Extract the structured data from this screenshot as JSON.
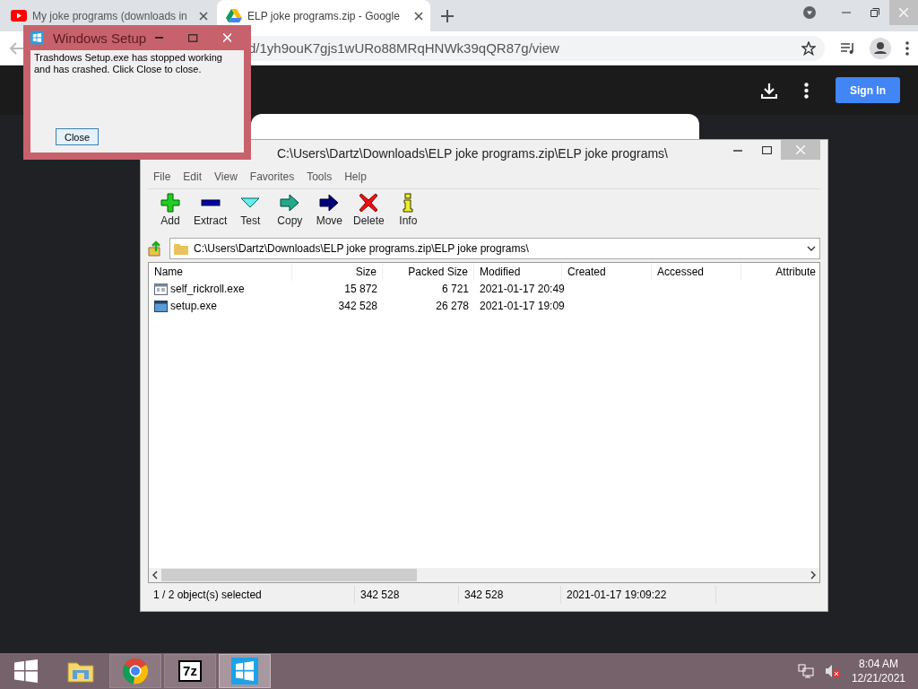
{
  "browser": {
    "tabs": [
      {
        "title": "My joke programs (downloads in",
        "kind": "video",
        "selected": false
      },
      {
        "title": "ELP joke programs.zip - Google",
        "kind": "drive",
        "selected": true
      }
    ],
    "url": "d/1yh9ouK7gjs1wURo88MRqHNWk39qQR87g/view"
  },
  "drive": {
    "sign_in": "Sign In"
  },
  "dialog": {
    "title": "Windows Setup",
    "message": "Trashdows Setup.exe has stopped working and has crashed. Click Close to close.",
    "button": "Close"
  },
  "archiver": {
    "title": "C:\\Users\\Dartz\\Downloads\\ELP joke programs.zip\\ELP joke programs\\",
    "menu": [
      "File",
      "Edit",
      "View",
      "Favorites",
      "Tools",
      "Help"
    ],
    "toolbar": [
      {
        "label": "Add",
        "kind": "add"
      },
      {
        "label": "Extract",
        "kind": "extract"
      },
      {
        "label": "Test",
        "kind": "test"
      },
      {
        "label": "Copy",
        "kind": "copy"
      },
      {
        "label": "Move",
        "kind": "move"
      },
      {
        "label": "Delete",
        "kind": "delete"
      },
      {
        "label": "Info",
        "kind": "info"
      }
    ],
    "path": "C:\\Users\\Dartz\\Downloads\\ELP joke programs.zip\\ELP joke programs\\",
    "columns": [
      "Name",
      "Size",
      "Packed Size",
      "Modified",
      "Created",
      "Accessed",
      "Attribute"
    ],
    "rows": [
      {
        "cells": [
          "self_rickroll.exe",
          "15 872",
          "6 721",
          "2021-01-17 20:49"
        ],
        "kind": "window"
      },
      {
        "cells": [
          "setup.exe",
          "342 528",
          "26 278",
          "2021-01-17 19:09"
        ],
        "kind": "app"
      }
    ],
    "status": [
      "1 / 2 object(s) selected",
      "342 528",
      "342 528",
      "2021-01-17 19:09:22"
    ]
  },
  "taskbar": {
    "items": [
      {
        "kind": "start",
        "running": false,
        "selected": false
      },
      {
        "kind": "folder",
        "running": false,
        "selected": false
      },
      {
        "kind": "chrome",
        "running": true,
        "selected": false
      },
      {
        "kind": "sevenzip",
        "label": "7z",
        "running": true,
        "selected": false
      },
      {
        "kind": "windows",
        "running": true,
        "selected": true
      }
    ],
    "time": "8:04 AM",
    "date": "12/21/2021"
  }
}
